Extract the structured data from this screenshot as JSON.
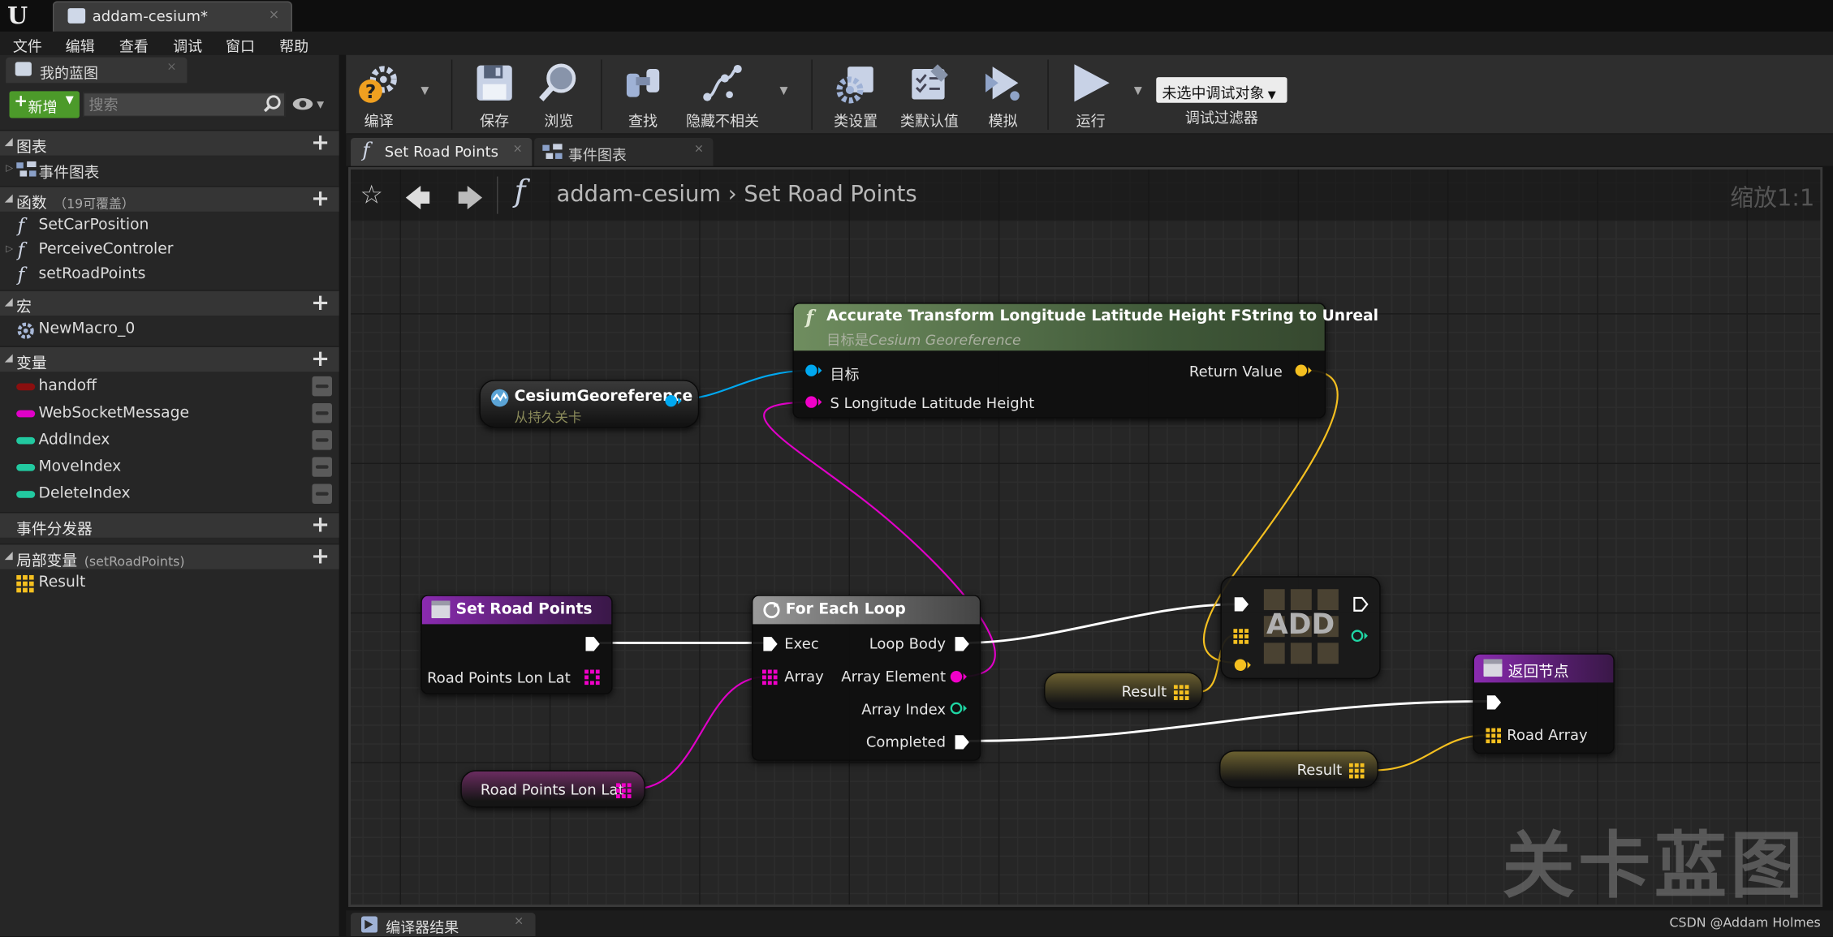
{
  "window": {
    "app_logo": "U",
    "doc_tab": "addam-cesium*",
    "doc_tab_close": "×"
  },
  "menu": [
    "文件",
    "编辑",
    "查看",
    "调试",
    "窗口",
    "帮助"
  ],
  "left_panel": {
    "tab_label": "我的蓝图",
    "tab_close": "×",
    "new_button": "新增",
    "search_placeholder": "搜索",
    "sections": {
      "graphs": {
        "label": "图表",
        "items": [
          "事件图表"
        ]
      },
      "functions": {
        "label": "函数",
        "sub": "（19可覆盖）",
        "items": [
          "SetCarPosition",
          "PerceiveControler",
          "setRoadPoints"
        ]
      },
      "macros": {
        "label": "宏",
        "items": [
          "NewMacro_0"
        ]
      },
      "variables": {
        "label": "变量",
        "items": [
          "handoff",
          "WebSocketMessage",
          "AddIndex",
          "MoveIndex",
          "DeleteIndex"
        ]
      },
      "dispatchers": {
        "label": "事件分发器"
      },
      "local_vars": {
        "label": "局部变量",
        "sub": "(setRoadPoints)",
        "items": [
          "Result"
        ]
      }
    },
    "variable_colors": [
      "#8a0f0f",
      "#e000c8",
      "#22c9a0",
      "#22c9a0",
      "#22c9a0"
    ]
  },
  "toolbar": {
    "compile": "编译",
    "save": "保存",
    "browse": "浏览",
    "find": "查找",
    "hide_unrelated": "隐藏不相关",
    "class_settings": "类设置",
    "class_defaults": "类默认值",
    "simulate": "模拟",
    "run": "运行",
    "debug_select": "未选中调试对象",
    "debug_filter": "调试过滤器"
  },
  "graph_tabs": [
    "Set Road Points",
    "事件图表"
  ],
  "graph_tab_close": "×",
  "breadcrumb": {
    "blueprint": "addam-cesium",
    "separator": "›",
    "function": "Set Road Points"
  },
  "zoom": "缩放1:1",
  "watermark": "关卡蓝图",
  "nodes": {
    "accurate_transform": {
      "title": "Accurate Transform Longitude Latitude Height FString to Unreal",
      "subtitle_prefix": "目标是",
      "subtitle_target": "Cesium Georeference",
      "pin_target": "目标",
      "pin_input": "S Longitude Latitude Height",
      "pin_return": "Return Value"
    },
    "cesium_ref": {
      "title": "CesiumGeoreference",
      "subtitle": "从持久关卡"
    },
    "set_road_points": {
      "title": "Set Road Points",
      "pin_out": "Road Points Lon Lat"
    },
    "for_each_loop": {
      "title": "For Each Loop",
      "pin_exec": "Exec",
      "pin_array": "Array",
      "pin_loop_body": "Loop Body",
      "pin_element": "Array Element",
      "pin_index": "Array Index",
      "pin_completed": "Completed"
    },
    "add": {
      "title": "ADD"
    },
    "return_node": {
      "title": "返回节点",
      "pin_road_array": "Road Array"
    },
    "get_road_points": {
      "title": "Road Points Lon Lat"
    },
    "get_result_1": {
      "title": "Result"
    },
    "get_result_2": {
      "title": "Result"
    }
  },
  "pin_colors": {
    "exec": "#ffffff",
    "object": "#00a8f0",
    "string": "#f000c8",
    "vector": "#f5c020",
    "integer": "#1fd6a4"
  },
  "bottom": {
    "compiler_results": "编译器结果",
    "tab_close": "×",
    "credit": "CSDN @Addam Holmes"
  }
}
